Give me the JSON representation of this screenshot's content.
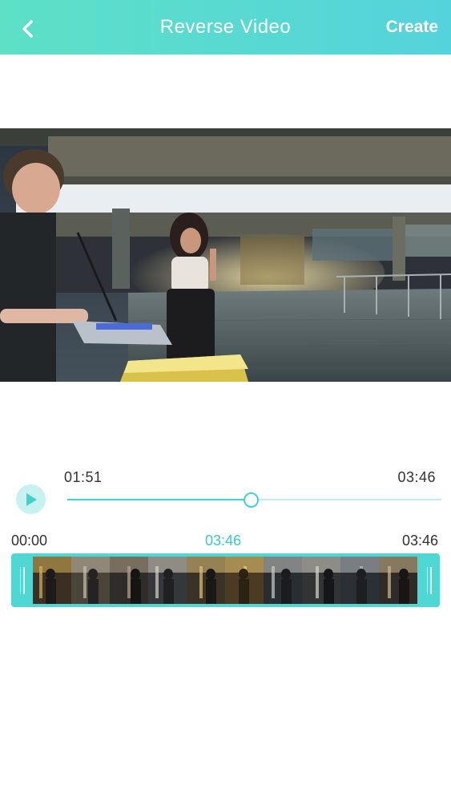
{
  "header": {
    "title": "Reverse Video",
    "create_label": "Create"
  },
  "player": {
    "current_time": "01:51",
    "total_time": "03:46",
    "progress": 0.49
  },
  "trim": {
    "start_label": "00:00",
    "selection_label": "03:46",
    "end_label": "03:46"
  },
  "filmstrip": {
    "frame_count": 10
  },
  "colors": {
    "accent": "#3fd2cf",
    "header_start": "#5de0c6",
    "header_end": "#55d3dc"
  }
}
